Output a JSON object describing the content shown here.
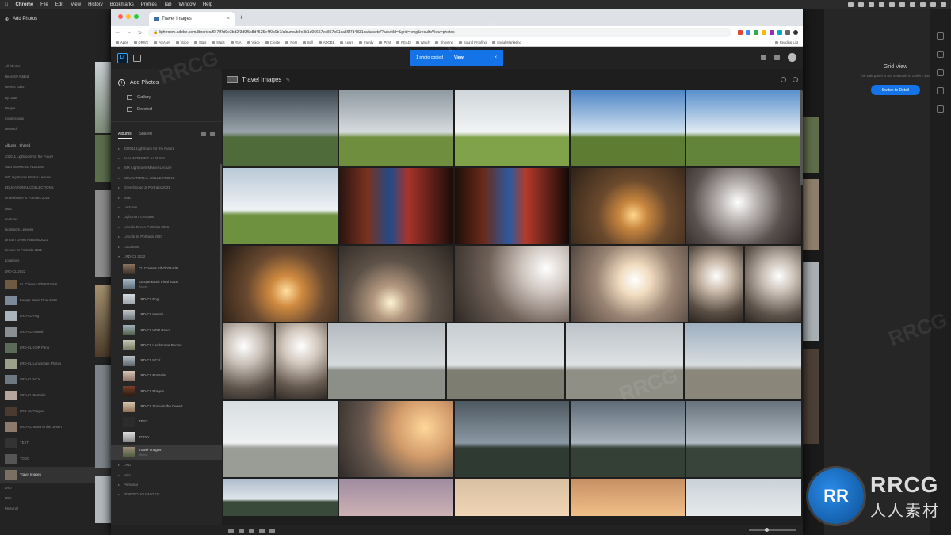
{
  "mac_menu": {
    "app": "Chrome",
    "items": [
      "File",
      "Edit",
      "View",
      "History",
      "Bookmarks",
      "Profiles",
      "Tab",
      "Window",
      "Help"
    ]
  },
  "browser": {
    "tab_title": "Travel Images",
    "url": "lightroom.adobe.com/libraries/f0-7ff7d0e3bd2f3d9f5c8d4525e4f0b0b7/albums/b9e3b1d06657ee857b01ca86f7d4831ca/assets/?assetId=&grid=cmg&resultsView=photos",
    "bookmarks": [
      "Apps",
      "DRIVE",
      "ASANA",
      "Voice",
      "Stats",
      "Maps",
      "YLA",
      "Voice",
      "Create",
      "Post",
      "Sell",
      "ADOBE",
      "Learn",
      "Family",
      "Print",
      "READ",
      "Watch",
      "Shooting",
      "Sound Proofing",
      "Social Marketing"
    ],
    "reading_list": "Reading List"
  },
  "lightroom": {
    "logo": "Lr",
    "toast": {
      "message": "1 photo copied",
      "action": "View"
    },
    "add_photos": "Add Photos",
    "nav": [
      "Gallery",
      "Deleted"
    ],
    "tabs": {
      "albums": "Albums",
      "shared": "Shared"
    },
    "albums": [
      "202011 Lightroom for the Future",
      "Auto WORKING ALBUMS",
      "IMX Lightroom Master Lecture",
      "EDUCATIONAL COLLECTIONS",
      "Greenhouse Jr Portraits 2021",
      "iMac",
      "Lectures",
      "Lightroom Lessons",
      "Lincoln Green Portraits 2021",
      "Lincoln Sr Portraits 2021",
      "Locations",
      "LRD-CL 2022"
    ],
    "subalbums": [
      {
        "name": "CL Classes 5/5/2022-5/6",
        "sub": ""
      },
      {
        "name": "Europe Basic Final 2018",
        "sub": "Shared"
      },
      {
        "name": "LRD-CL Fog",
        "sub": ""
      },
      {
        "name": "LRD-CL Hawaii",
        "sub": ""
      },
      {
        "name": "LRD-CL HDR Pano",
        "sub": ""
      },
      {
        "name": "LRD-CL Landscape Photos",
        "sub": ""
      },
      {
        "name": "LRD-CL NCal",
        "sub": ""
      },
      {
        "name": "LRD-CL Portraits",
        "sub": ""
      },
      {
        "name": "LRD-CL Prague",
        "sub": ""
      },
      {
        "name": "LRD-CL Snow in the Desert",
        "sub": ""
      },
      {
        "name": "TEST",
        "sub": ""
      },
      {
        "name": "TODO",
        "sub": ""
      },
      {
        "name": "Travel Images",
        "sub": "Shared"
      }
    ],
    "albums_after": [
      "LRD",
      "Misc",
      "Personal",
      "PORTFOLIO IMAGES"
    ],
    "content_title": "Travel Images"
  },
  "right_panel": {
    "title": "Grid View",
    "subtitle": "The Edit panel is not available in Gallery view",
    "button": "Switch to Detail"
  },
  "background_panel": {
    "title": "Add Photos",
    "rows": [
      "All Photos",
      "Recently Added",
      "Recent Edits",
      "By Date",
      "People",
      "Connections",
      "Deleted"
    ],
    "tabs": [
      "Albums",
      "Shared"
    ]
  },
  "watermark": {
    "brand": "RRCG",
    "cn": "人人素材",
    "logo_letters": "RR"
  }
}
